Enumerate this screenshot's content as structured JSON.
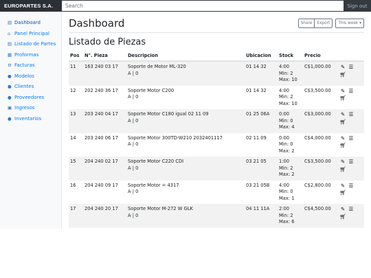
{
  "topbar": {
    "brand": "EUROPARTES S.A.",
    "search_placeholder": "Search",
    "signout": "Sign out"
  },
  "sidebar": {
    "items": [
      {
        "label": "Dashboard",
        "icon": "dashboard-icon",
        "glyph": "▤"
      },
      {
        "label": "Panel Principal",
        "icon": "home-icon",
        "glyph": "⌂"
      },
      {
        "label": "Listado de Partes",
        "icon": "list-icon",
        "glyph": "▤"
      },
      {
        "label": "Proformas",
        "icon": "document-icon",
        "glyph": "▦"
      },
      {
        "label": "Facturas",
        "icon": "settings-icon",
        "glyph": "⚙"
      },
      {
        "label": "Modelos",
        "icon": "users-icon",
        "glyph": "●"
      },
      {
        "label": "Clientes",
        "icon": "users-icon",
        "glyph": "●"
      },
      {
        "label": "Proveedores",
        "icon": "user-icon",
        "glyph": "●"
      },
      {
        "label": "Ingresos",
        "icon": "box-icon",
        "glyph": "▣"
      },
      {
        "label": "Inventarios",
        "icon": "info-icon",
        "glyph": "●"
      }
    ]
  },
  "header": {
    "title": "Dashboard",
    "share": "Share",
    "export": "Export",
    "period": "This week ▾"
  },
  "list": {
    "title": "Listado de Piezas",
    "columns": [
      "Pos",
      "N°. Pieza",
      "Descripcion",
      "Ubicacion",
      "Stock",
      "Precio"
    ],
    "rows": [
      {
        "pos": "11",
        "num": "163 240 03 17",
        "desc": "Soporte de Motor ML-320",
        "sub": "A | 0",
        "ubi": "01 14 32",
        "stock": "4:00",
        "min": "Min: 2",
        "max": "Max: 10",
        "precio": "C$1,000.00"
      },
      {
        "pos": "12",
        "num": "202 240 36 17",
        "desc": "Soporte Motor C200",
        "sub": "A | 0",
        "ubi": "01 14 32",
        "stock": "4:00",
        "min": "Min: 2",
        "max": "Max: 10",
        "precio": "C$3,500.00"
      },
      {
        "pos": "13",
        "num": "203 240 04 17",
        "desc": "Soporte Motor C180 igual 02 11 09",
        "sub": "A | 0",
        "ubi": "01 25 06A",
        "stock": "0:00",
        "min": "Min: 0",
        "max": "Max: 4",
        "precio": "C$3,000.00"
      },
      {
        "pos": "14",
        "num": "203 240 06 17",
        "desc": "Soporte Motor 300TD-W210 2032401117",
        "sub": "A | 0",
        "ubi": "02 11 09",
        "stock": "0:00",
        "min": "Min: 0",
        "max": "Max: 2",
        "precio": "C$4,000.00"
      },
      {
        "pos": "15",
        "num": "204 240 02 17",
        "desc": "Soporte Motor C220 CDI",
        "sub": "A | 0",
        "ubi": "03 21 05",
        "stock": "1:00",
        "min": "Min: 2",
        "max": "Max: 2",
        "precio": "C$3,500.00"
      },
      {
        "pos": "16",
        "num": "204 240 09 17",
        "desc": "Soporte Motor = 4317",
        "sub": "A | 0",
        "ubi": "03 21 05B",
        "stock": "4:00",
        "min": "Min: 0",
        "max": "Max: 1",
        "precio": "C$2,800.00"
      },
      {
        "pos": "17",
        "num": "204 240 20 17",
        "desc": "Soporte Motor M-272 W GLK",
        "sub": "A | 0",
        "ubi": "04 11 11A",
        "stock": "2:00",
        "min": "Min: 2",
        "max": "Max: 6",
        "precio": "C$4,500.00"
      }
    ]
  },
  "actions": {
    "edit": "pencil-icon",
    "list": "list-icon",
    "cart": "cart-icon"
  }
}
